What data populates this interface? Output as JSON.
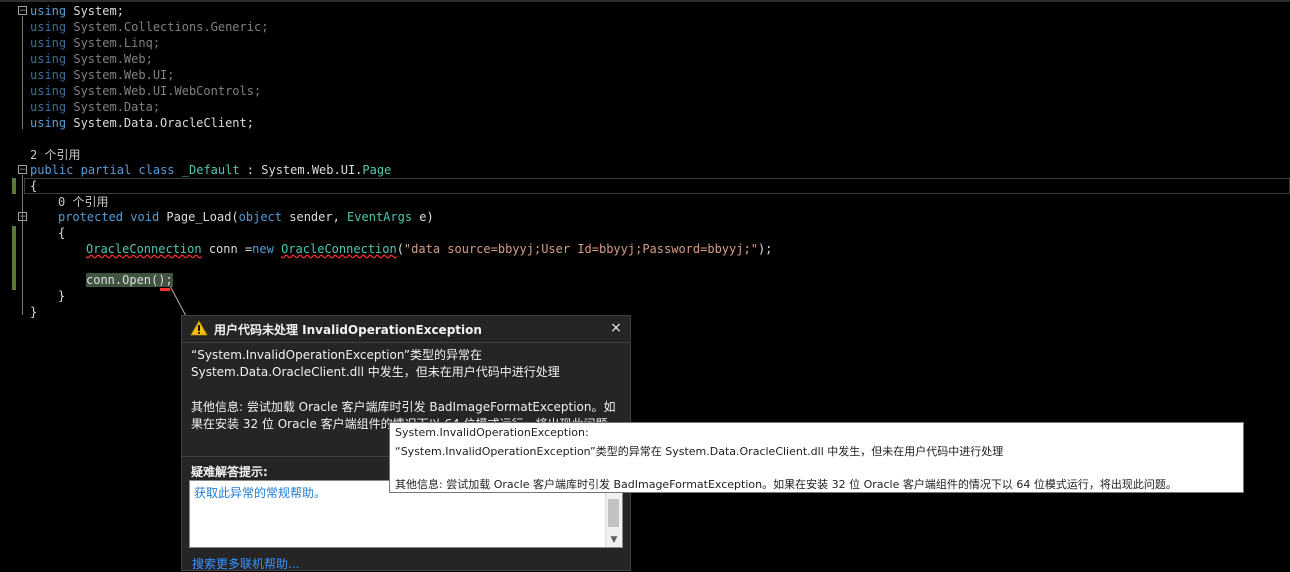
{
  "code": {
    "using_lines": [
      "System;",
      "System.Collections.Generic;",
      "System.Linq;",
      "System.Web;",
      "System.Web.UI;",
      "System.Web.UI.WebControls;",
      "System.Data;",
      "System.Data.OracleClient;"
    ],
    "using_kw": "using",
    "ref_count_class": "2 个引用",
    "class_kw1": "public",
    "class_kw2": "partial",
    "class_kw3": "class",
    "class_name": "_Default",
    "class_colon": " : ",
    "class_base_prefix": "System.Web.UI.",
    "class_base_type": "Page",
    "brace_open": "{",
    "brace_close": "}",
    "ref_count_method": "0 个引用",
    "method_kw1": "protected",
    "method_kw2": "void",
    "method_name": " Page_Load(",
    "method_param_kw": "object",
    "method_param1": " sender, ",
    "method_param_type": "EventArgs",
    "method_param2": " e)",
    "conn_type": "OracleConnection",
    "conn_var": " conn =",
    "conn_new": "new",
    "conn_type2": "OracleConnection",
    "conn_paren": "(",
    "conn_string": "\"data source=bbyyj;User Id=bbyyj;Password=bbyyj;\"",
    "conn_end": ");",
    "open_call": "conn.Open();"
  },
  "exception": {
    "title": "用户代码未处理 InvalidOperationException",
    "close_label": "×",
    "message_line1": "“System.InvalidOperationException”类型的异常在",
    "message_line2": "System.Data.OracleClient.dll 中发生，但未在用户代码中进行处理",
    "info_line1": "其他信息: 尝试加载 Oracle 客户端库时引发 BadImageFormatException。如",
    "info_line2": "果在安装 32 位 Oracle 客户端组件的情况下以 64 位模式运行，将出现此问题。",
    "hint_label": "疑难解答提示:",
    "hint_link": "获取此异常的常规帮助。",
    "more_help": "搜索更多联机帮助..."
  },
  "tooltip": {
    "line1": "System.InvalidOperationException:",
    "line2": "“System.InvalidOperationException”类型的异常在 System.Data.OracleClient.dll 中发生，但未在用户代码中进行处理",
    "line3": "其他信息: 尝试加载 Oracle 客户端库时引发 BadImageFormatException。如果在安装 32 位 Oracle 客户端组件的情况下以 64 位模式运行，将出现此问题。"
  },
  "colors": {
    "editor_bg": "#000000",
    "keyword": "#569cd6",
    "type": "#4ec9b0",
    "string": "#d69d85",
    "link": "#3794ff"
  }
}
